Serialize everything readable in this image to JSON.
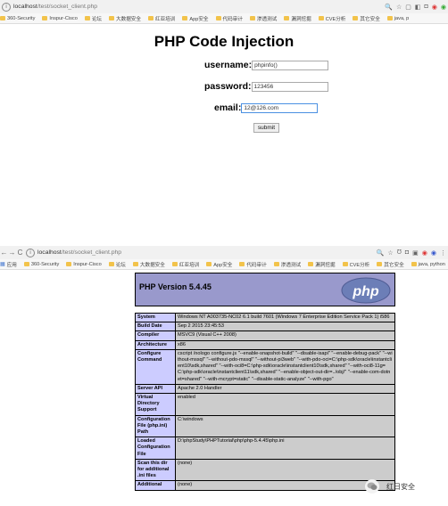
{
  "top_browser": {
    "url_host": "localhost",
    "url_path": "/test/socket_client.php",
    "bookmarks": [
      "360-Security",
      "Inspur-Cisco",
      "论坛",
      "大数据安全",
      "红亚培训",
      "App安全",
      "代码审计",
      "渗透测试",
      "漏洞挖掘",
      "CVE分析",
      "其它安全",
      "java, p"
    ]
  },
  "form": {
    "title": "PHP Code Injection",
    "username_label": "username:",
    "username_value": "phpinfo()",
    "password_label": "password:",
    "password_value": "123456",
    "email_label": "email:",
    "email_value": "12@126.com",
    "submit_label": "submit"
  },
  "bottom_browser": {
    "url_host": "localhost",
    "url_path": "/test/socket_client.php",
    "apps_label": "应用",
    "bookmarks": [
      "360-Security",
      "Inspur-Cisco",
      "论坛",
      "大数据安全",
      "红亚培训",
      "App安全",
      "代码审计",
      "渗透测试",
      "漏洞挖掘",
      "CVE分析",
      "其它安全",
      "java, python"
    ]
  },
  "phpinfo": {
    "version_title": "PHP Version 5.4.45",
    "logo_text": "php",
    "rows": [
      {
        "key": "System",
        "value": "Windows NT A003735-NC02 6.1 build 7601 (Windows 7 Enterprise Edition Service Pack 1) i586"
      },
      {
        "key": "Build Date",
        "value": "Sep 2 2015 23:45:53"
      },
      {
        "key": "Compiler",
        "value": "MSVC9 (Visual C++ 2008)"
      },
      {
        "key": "Architecture",
        "value": "x86"
      },
      {
        "key": "Configure Command",
        "value": "cscript /nologo configure.js \"--enable-snapshot-build\" \"--disable-isapi\" \"--enable-debug-pack\" \"--without-mssql\" \"--without-pdo-mssql\" \"--without-pi3web\" \"--with-pdo-oci=C:\\php-sdk\\oracle\\instantclient10\\sdk,shared\" \"--with-oci8=C:\\php-sdk\\oracle\\instantclient10\\sdk,shared\" \"--with-oci8-11g=C:\\php-sdk\\oracle\\instantclient11\\sdk,shared\" \"--enable-object-out-dir=../obj/\" \"--enable-com-dotnet=shared\" \"--with-mcrypt=static\" \"--disable-static-analyze\" \"--with-pgo\""
      },
      {
        "key": "Server API",
        "value": "Apache 2.0 Handler"
      },
      {
        "key": "Virtual Directory Support",
        "value": "enabled"
      },
      {
        "key": "Configuration File (php.ini) Path",
        "value": "C:\\windows"
      },
      {
        "key": "Loaded Configuration File",
        "value": "D:\\phpStudy\\PHPTutorial\\php\\php-5.4.45\\php.ini"
      },
      {
        "key": "Scan this dir for additional .ini files",
        "value": "(none)"
      },
      {
        "key": "Additional",
        "value": "(none)"
      }
    ]
  },
  "watermark": {
    "text": "红日安全"
  },
  "colors": {
    "php_header": "#9999cc",
    "php_key_cell": "#ccccff",
    "php_value_cell": "#cccccc",
    "focus_border": "#4a90e2"
  }
}
